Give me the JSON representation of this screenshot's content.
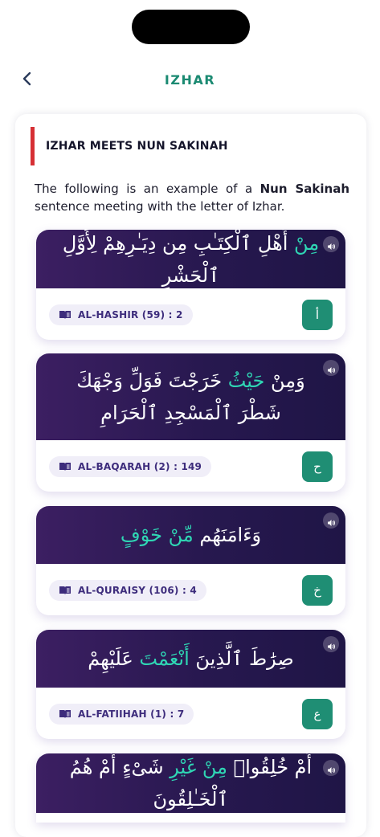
{
  "header": {
    "title": "IZHAR"
  },
  "section": {
    "title": "IZHAR MEETS NUN SAKINAH",
    "intro_before": "The following is an example of a ",
    "intro_bold": "Nun Sakinah",
    "intro_after": " sentence meeting with the letter of Izhar."
  },
  "examples": [
    {
      "verse_before": "",
      "verse_highlight": "مِنْ",
      "verse_after": " أَهْلِ ٱلْكِتَـٰبِ مِن دِيَـٰرِهِمْ لِأَوَّلِ ٱلْحَشْرِ",
      "reference": "AL-HASHIR (59) : 2",
      "letter": "أ"
    },
    {
      "verse_before": "وَمِنْ ",
      "verse_highlight": "حَيْثُ",
      "verse_after": " خَرَجْتَ فَوَلِّ وَجْهَكَ شَطْرَ ٱلْمَسْجِدِ ٱلْحَرَامِ",
      "reference": "AL-BAQARAH (2) : 149",
      "letter": "ح"
    },
    {
      "verse_before": "وَءَامَنَهُم ",
      "verse_highlight": "مِّنْ خَوْفٍ",
      "verse_after": "",
      "reference": "AL-QURAISY (106) : 4",
      "letter": "خ"
    },
    {
      "verse_before": "صِرَٰطَ ٱلَّذِينَ ",
      "verse_highlight": "أَنْعَمْتَ",
      "verse_after": " عَلَيْهِمْ",
      "reference": "AL-FATIIHAH (1) : 7",
      "letter": "ع"
    },
    {
      "verse_before": "أَمْ خُلِقُوا۟ ",
      "verse_highlight": "مِنْ غَيْرِ",
      "verse_after": " شَىْءٍ أَمْ هُمُ ٱلْخَـٰلِقُونَ",
      "reference": "",
      "letter": ""
    }
  ],
  "colors": {
    "accent": "#1b8a72",
    "section_bar": "#d62f34",
    "verse_bg": "#27184f",
    "verse_highlight": "#2fd6b4",
    "letter_button": "#1f8e74"
  },
  "icons": {
    "back": "chevron-left-icon",
    "audio": "speaker-icon",
    "reference": "book-icon"
  }
}
